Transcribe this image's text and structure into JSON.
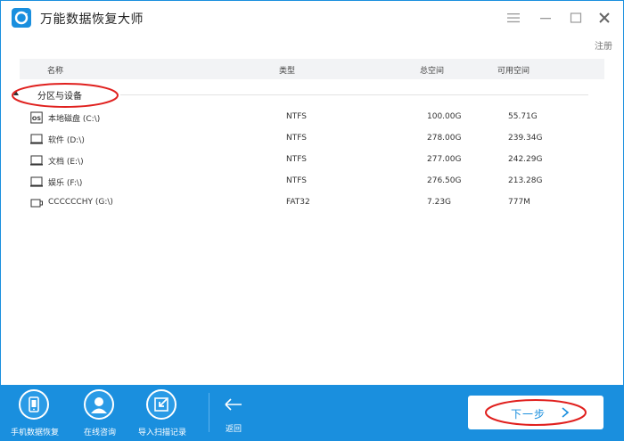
{
  "app": {
    "title": "万能数据恢复大师",
    "register_label": "注册"
  },
  "table": {
    "headers": {
      "name": "名称",
      "type": "类型",
      "total": "总空间",
      "available": "可用空间"
    },
    "group_label": "分区与设备",
    "rows": [
      {
        "name": "本地磁盘 (C:\\)",
        "type": "NTFS",
        "total": "100.00G",
        "available": "55.71G",
        "icon": "os-disk-icon"
      },
      {
        "name": "软件 (D:\\)",
        "type": "NTFS",
        "total": "278.00G",
        "available": "239.34G",
        "icon": "disk-icon"
      },
      {
        "name": "文档 (E:\\)",
        "type": "NTFS",
        "total": "277.00G",
        "available": "242.29G",
        "icon": "disk-icon"
      },
      {
        "name": "娱乐 (F:\\)",
        "type": "NTFS",
        "total": "276.50G",
        "available": "213.28G",
        "icon": "disk-icon"
      },
      {
        "name": "CCCCCCHY (G:\\)",
        "type": "FAT32",
        "total": "7.23G",
        "available": "777M",
        "icon": "usb-drive-icon"
      }
    ]
  },
  "footer": {
    "phone_recovery": "手机数据恢复",
    "online_consult": "在线咨询",
    "import_scan": "导入扫描记录",
    "back": "返回",
    "next": "下一步"
  },
  "colors": {
    "accent": "#1a8fde",
    "annotation_red": "#e0201e"
  }
}
